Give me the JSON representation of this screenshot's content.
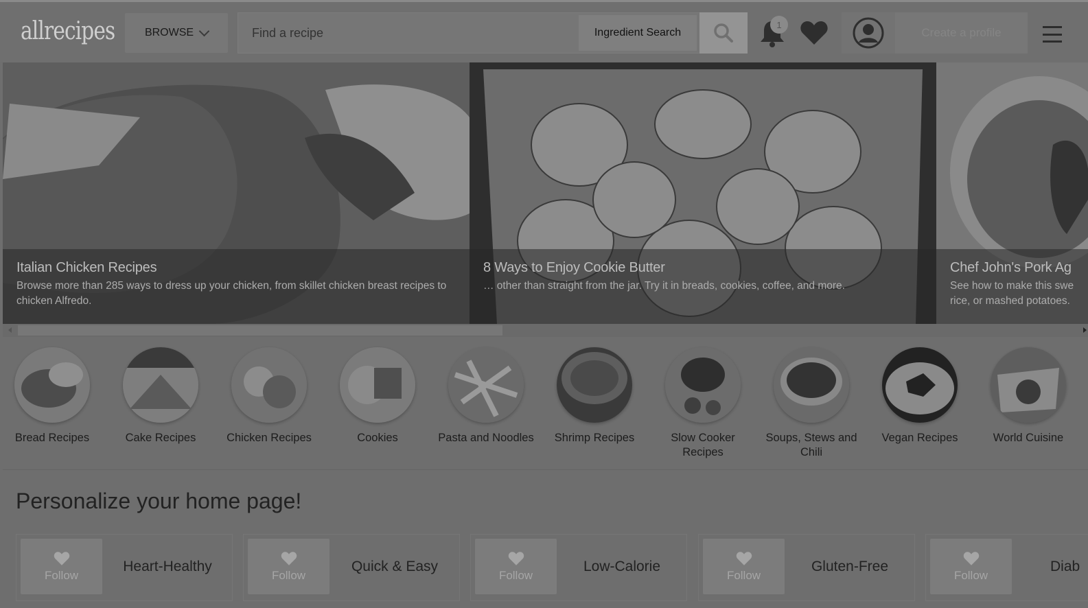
{
  "header": {
    "logo": "allrecipes",
    "browse_label": "BROWSE",
    "search_placeholder": "Find a recipe",
    "ingredient_search_label": "Ingredient Search",
    "notification_count": "1",
    "create_profile_label": "Create a profile"
  },
  "carousel": [
    {
      "title": "Italian Chicken Recipes",
      "text": "Browse more than 285 ways to dress up your chicken, from skillet chicken breast recipes to chicken Alfredo."
    },
    {
      "title": "8 Ways to Enjoy Cookie Butter",
      "text": "… other than straight from the jar. Try it in breads, cookies, coffee, and more."
    },
    {
      "title": "Chef John's Pork Ag",
      "text": "See how to make this swe rice, or mashed potatoes."
    }
  ],
  "categories": [
    {
      "label": "Bread Recipes"
    },
    {
      "label": "Cake Recipes"
    },
    {
      "label": "Chicken Recipes"
    },
    {
      "label": "Cookies"
    },
    {
      "label": "Pasta and Noodles"
    },
    {
      "label": "Shrimp Recipes"
    },
    {
      "label": "Slow Cooker Recipes"
    },
    {
      "label": "Soups, Stews and Chili"
    },
    {
      "label": "Vegan Recipes"
    },
    {
      "label": "World Cuisine"
    }
  ],
  "personalize": {
    "title": "Personalize your home page!",
    "follow_label": "Follow",
    "items": [
      {
        "name": "Heart-Healthy"
      },
      {
        "name": "Quick & Easy"
      },
      {
        "name": "Low-Calorie"
      },
      {
        "name": "Gluten-Free"
      },
      {
        "name": "Diab"
      }
    ]
  },
  "colors": {
    "overlay_gray": "#6e6e6e",
    "button_gray": "#949494"
  }
}
